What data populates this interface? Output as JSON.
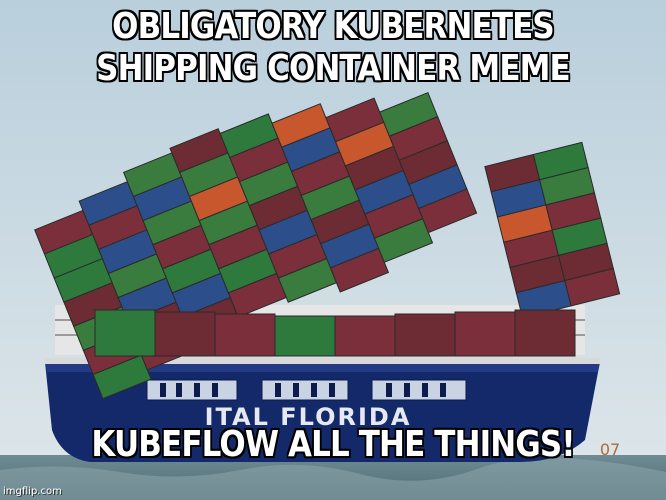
{
  "meme": {
    "top_line1": "OBLIGATORY KUBERNETES",
    "top_line2": "SHIPPING CONTAINER MEME",
    "bottom_text": "KUBEFLOW ALL THE THINGS!",
    "ship_name": "ITAL FLORIDA",
    "hull_number": "07",
    "watermark": "imgflip.com"
  }
}
